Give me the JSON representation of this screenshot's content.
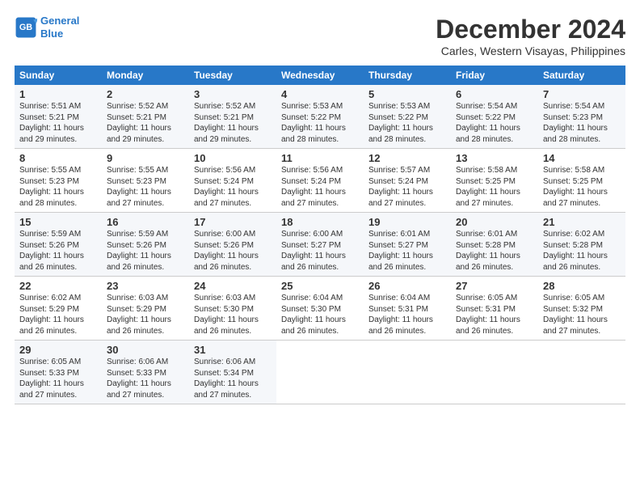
{
  "logo": {
    "line1": "General",
    "line2": "Blue"
  },
  "title": "December 2024",
  "subtitle": "Carles, Western Visayas, Philippines",
  "days_of_week": [
    "Sunday",
    "Monday",
    "Tuesday",
    "Wednesday",
    "Thursday",
    "Friday",
    "Saturday"
  ],
  "weeks": [
    [
      {
        "day": 1,
        "sunrise": "5:51 AM",
        "sunset": "5:21 PM",
        "daylight": "11 hours and 29 minutes."
      },
      {
        "day": 2,
        "sunrise": "5:52 AM",
        "sunset": "5:21 PM",
        "daylight": "11 hours and 29 minutes."
      },
      {
        "day": 3,
        "sunrise": "5:52 AM",
        "sunset": "5:21 PM",
        "daylight": "11 hours and 29 minutes."
      },
      {
        "day": 4,
        "sunrise": "5:53 AM",
        "sunset": "5:22 PM",
        "daylight": "11 hours and 28 minutes."
      },
      {
        "day": 5,
        "sunrise": "5:53 AM",
        "sunset": "5:22 PM",
        "daylight": "11 hours and 28 minutes."
      },
      {
        "day": 6,
        "sunrise": "5:54 AM",
        "sunset": "5:22 PM",
        "daylight": "11 hours and 28 minutes."
      },
      {
        "day": 7,
        "sunrise": "5:54 AM",
        "sunset": "5:23 PM",
        "daylight": "11 hours and 28 minutes."
      }
    ],
    [
      {
        "day": 8,
        "sunrise": "5:55 AM",
        "sunset": "5:23 PM",
        "daylight": "11 hours and 28 minutes."
      },
      {
        "day": 9,
        "sunrise": "5:55 AM",
        "sunset": "5:23 PM",
        "daylight": "11 hours and 27 minutes."
      },
      {
        "day": 10,
        "sunrise": "5:56 AM",
        "sunset": "5:24 PM",
        "daylight": "11 hours and 27 minutes."
      },
      {
        "day": 11,
        "sunrise": "5:56 AM",
        "sunset": "5:24 PM",
        "daylight": "11 hours and 27 minutes."
      },
      {
        "day": 12,
        "sunrise": "5:57 AM",
        "sunset": "5:24 PM",
        "daylight": "11 hours and 27 minutes."
      },
      {
        "day": 13,
        "sunrise": "5:58 AM",
        "sunset": "5:25 PM",
        "daylight": "11 hours and 27 minutes."
      },
      {
        "day": 14,
        "sunrise": "5:58 AM",
        "sunset": "5:25 PM",
        "daylight": "11 hours and 27 minutes."
      }
    ],
    [
      {
        "day": 15,
        "sunrise": "5:59 AM",
        "sunset": "5:26 PM",
        "daylight": "11 hours and 26 minutes."
      },
      {
        "day": 16,
        "sunrise": "5:59 AM",
        "sunset": "5:26 PM",
        "daylight": "11 hours and 26 minutes."
      },
      {
        "day": 17,
        "sunrise": "6:00 AM",
        "sunset": "5:26 PM",
        "daylight": "11 hours and 26 minutes."
      },
      {
        "day": 18,
        "sunrise": "6:00 AM",
        "sunset": "5:27 PM",
        "daylight": "11 hours and 26 minutes."
      },
      {
        "day": 19,
        "sunrise": "6:01 AM",
        "sunset": "5:27 PM",
        "daylight": "11 hours and 26 minutes."
      },
      {
        "day": 20,
        "sunrise": "6:01 AM",
        "sunset": "5:28 PM",
        "daylight": "11 hours and 26 minutes."
      },
      {
        "day": 21,
        "sunrise": "6:02 AM",
        "sunset": "5:28 PM",
        "daylight": "11 hours and 26 minutes."
      }
    ],
    [
      {
        "day": 22,
        "sunrise": "6:02 AM",
        "sunset": "5:29 PM",
        "daylight": "11 hours and 26 minutes."
      },
      {
        "day": 23,
        "sunrise": "6:03 AM",
        "sunset": "5:29 PM",
        "daylight": "11 hours and 26 minutes."
      },
      {
        "day": 24,
        "sunrise": "6:03 AM",
        "sunset": "5:30 PM",
        "daylight": "11 hours and 26 minutes."
      },
      {
        "day": 25,
        "sunrise": "6:04 AM",
        "sunset": "5:30 PM",
        "daylight": "11 hours and 26 minutes."
      },
      {
        "day": 26,
        "sunrise": "6:04 AM",
        "sunset": "5:31 PM",
        "daylight": "11 hours and 26 minutes."
      },
      {
        "day": 27,
        "sunrise": "6:05 AM",
        "sunset": "5:31 PM",
        "daylight": "11 hours and 26 minutes."
      },
      {
        "day": 28,
        "sunrise": "6:05 AM",
        "sunset": "5:32 PM",
        "daylight": "11 hours and 27 minutes."
      }
    ],
    [
      {
        "day": 29,
        "sunrise": "6:05 AM",
        "sunset": "5:33 PM",
        "daylight": "11 hours and 27 minutes."
      },
      {
        "day": 30,
        "sunrise": "6:06 AM",
        "sunset": "5:33 PM",
        "daylight": "11 hours and 27 minutes."
      },
      {
        "day": 31,
        "sunrise": "6:06 AM",
        "sunset": "5:34 PM",
        "daylight": "11 hours and 27 minutes."
      },
      null,
      null,
      null,
      null
    ]
  ]
}
